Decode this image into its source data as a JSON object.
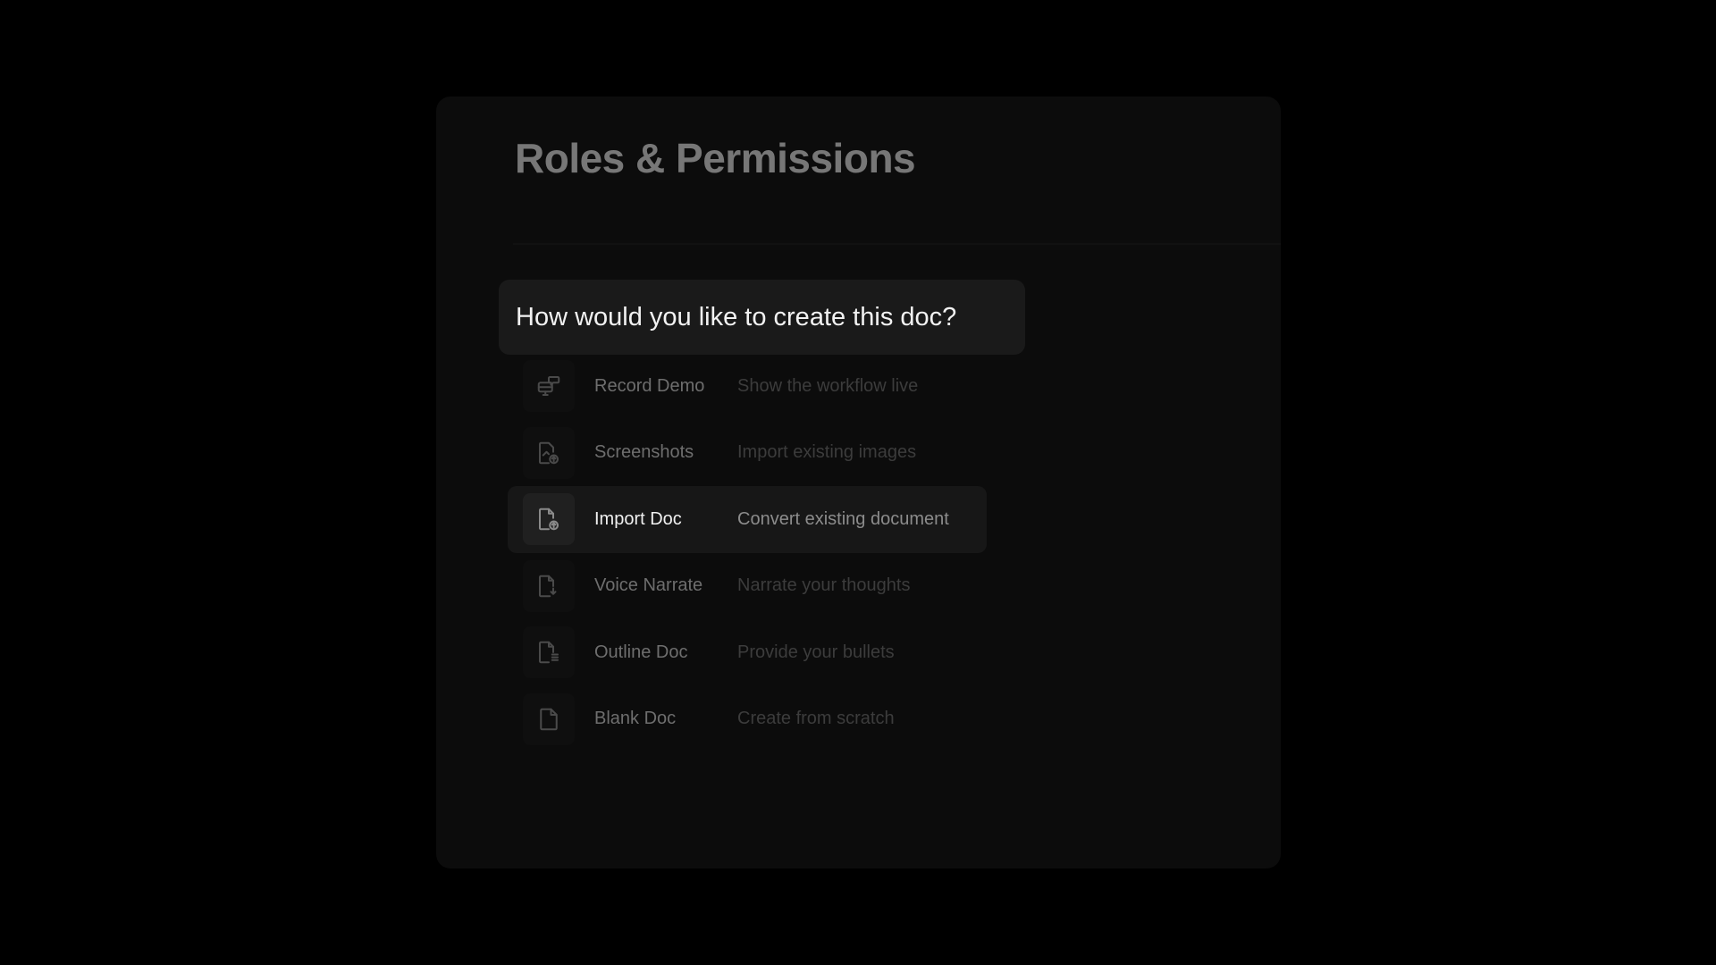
{
  "page": {
    "title": "Roles & Permissions"
  },
  "dialog": {
    "prompt": "How would you like to create this doc?",
    "options": [
      {
        "id": "record-demo",
        "icon": "monitor-chat-icon",
        "label": "Record Demo",
        "description": "Show the workflow live",
        "selected": false
      },
      {
        "id": "screenshots",
        "icon": "image-file-upload-icon",
        "label": "Screenshots",
        "description": "Import existing images",
        "selected": false
      },
      {
        "id": "import-doc",
        "icon": "file-upload-icon",
        "label": "Import Doc",
        "description": "Convert existing document",
        "selected": true
      },
      {
        "id": "voice-narrate",
        "icon": "file-mic-icon",
        "label": "Voice Narrate",
        "description": "Narrate your thoughts",
        "selected": false
      },
      {
        "id": "outline-doc",
        "icon": "file-list-icon",
        "label": "Outline Doc",
        "description": "Provide your bullets",
        "selected": false
      },
      {
        "id": "blank-doc",
        "icon": "blank-file-icon",
        "label": "Blank Doc",
        "description": "Create from scratch",
        "selected": false
      }
    ]
  }
}
